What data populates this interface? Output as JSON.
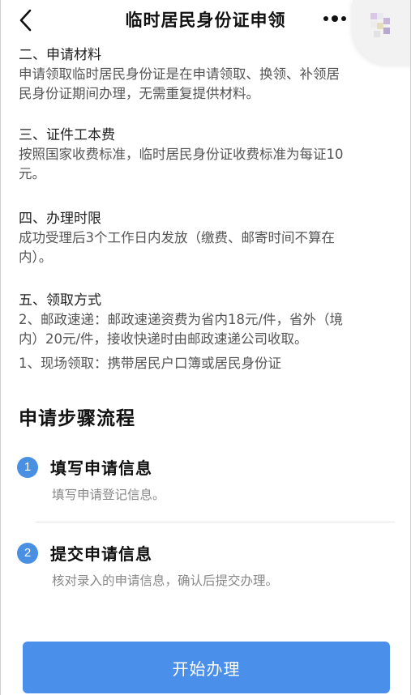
{
  "navbar": {
    "title": "临时居民身份证申领",
    "back_icon": "chevron-left-icon",
    "more_icon": "more-dots-icon"
  },
  "sections": [
    {
      "title": "二、申请材料",
      "lines": [
        "申请领取临时居民身份证是在申请领取、换领、补领居",
        "民身份证期间办理，无需重复提供材料。"
      ]
    },
    {
      "title": "三、证件工本费",
      "lines": [
        "按照国家收费标准，临时居民身份证收费标准为每证10",
        "元。"
      ]
    },
    {
      "title": "四、办理时限",
      "lines": [
        "成功受理后3个工作日内发放（缴费、邮寄时间不算在",
        "内）。"
      ]
    },
    {
      "title": "五、领取方式",
      "lines": [
        "2、邮政速递：邮政速递资费为省内18元/件，省外（境",
        "内）20元/件，接收快递时由邮政速递公司收取。"
      ],
      "extra": "1、现场领取：携带居民户口簿或居民身份证"
    }
  ],
  "steps": {
    "heading": "申请步骤流程",
    "items": [
      {
        "num": "1",
        "title": "填写申请信息",
        "desc": "填写申请登记信息。"
      },
      {
        "num": "2",
        "title": "提交申请信息",
        "desc": "核对录入的申请信息，确认后提交办理。"
      }
    ]
  },
  "actions": {
    "start_label": "开始办理"
  },
  "colors": {
    "accent": "#4a8fe9",
    "step_badge": "#4a90e2"
  }
}
